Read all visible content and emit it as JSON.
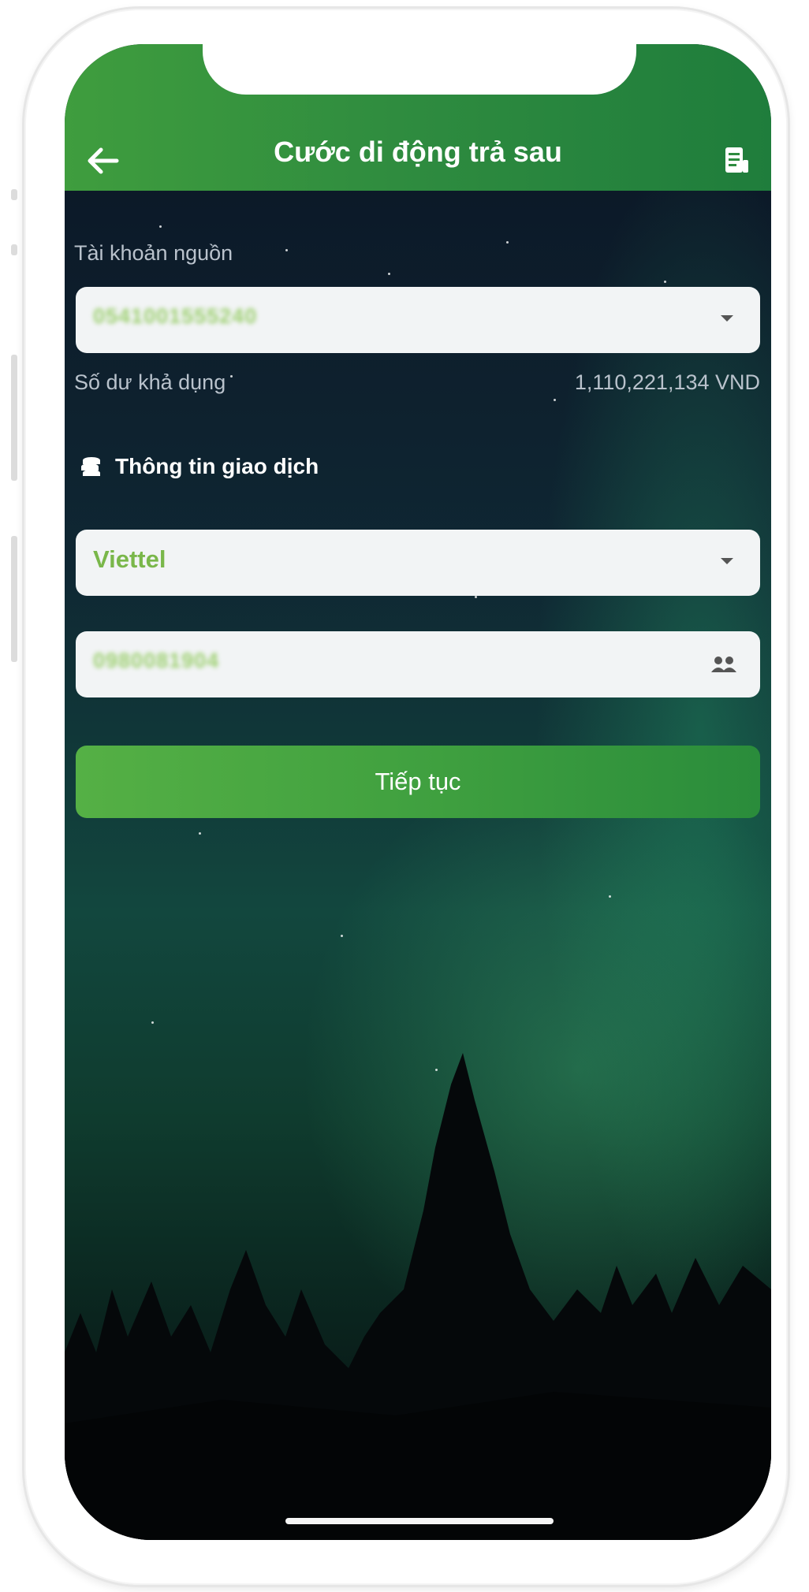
{
  "header": {
    "title": "Cước di động trả sau",
    "back_icon": "arrow-left-icon",
    "right_icon": "receipt-icon"
  },
  "source_account": {
    "label": "Tài khoản nguồn",
    "value": "0541001555240",
    "balance_label": "Số dư khả dụng",
    "balance_value": "1,110,221,134 VND"
  },
  "transaction_info": {
    "section_title": "Thông tin giao dịch",
    "provider": "Viettel",
    "phone_number": "0980081904"
  },
  "actions": {
    "continue_label": "Tiếp tục"
  },
  "colors": {
    "primary_green": "#3e9f3f",
    "accent_text": "#7ab74a",
    "field_bg": "#f2f4f5"
  }
}
